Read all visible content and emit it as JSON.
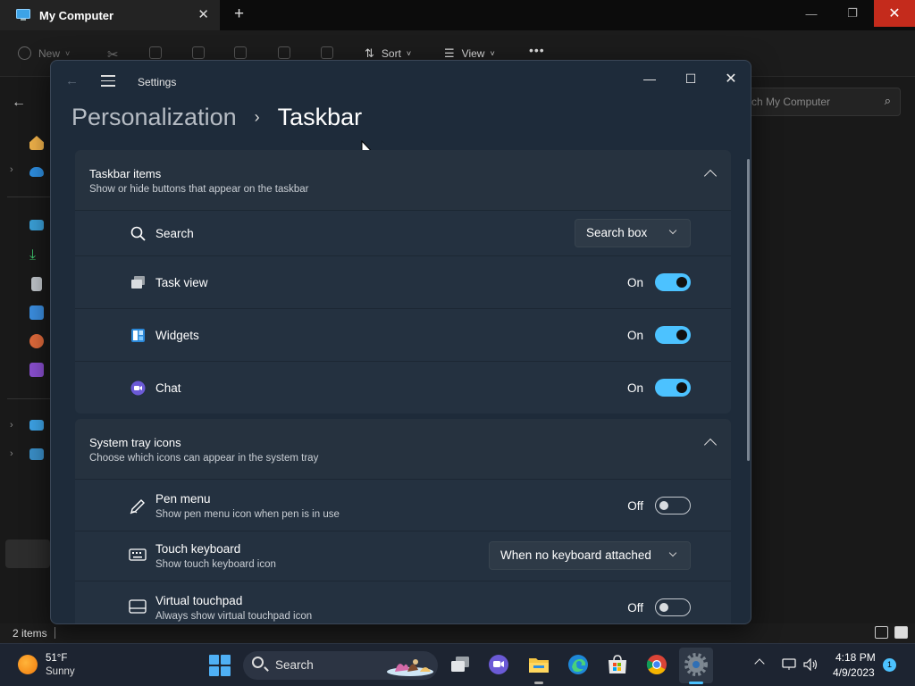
{
  "explorer": {
    "tab_title": "My Computer",
    "tab_close": "✕",
    "new_tab": "+",
    "window_buttons": {
      "minimize": "—",
      "maximize": "❐",
      "close": "✕"
    },
    "toolbar": {
      "new": "New",
      "sort": "Sort",
      "view": "View",
      "more": "•••",
      "cut_icon": "✂"
    },
    "back": "←",
    "search_placeholder": "Search My Computer",
    "search_display": "ch My Computer",
    "search_icon": "⌕",
    "status_text": "2 items"
  },
  "settings": {
    "app_title": "Settings",
    "back_icon": "←",
    "window_buttons": {
      "minimize": "—",
      "maximize": "☐",
      "close": "✕"
    },
    "breadcrumb": {
      "parent": "Personalization",
      "separator": "›",
      "current": "Taskbar"
    },
    "sections": {
      "taskbar_items": {
        "title": "Taskbar items",
        "subtitle": "Show or hide buttons that appear on the taskbar",
        "search": {
          "label": "Search",
          "value": "Search box"
        },
        "task_view": {
          "label": "Task view",
          "state": "On"
        },
        "widgets": {
          "label": "Widgets",
          "state": "On"
        },
        "chat": {
          "label": "Chat",
          "state": "On"
        }
      },
      "system_tray": {
        "title": "System tray icons",
        "subtitle": "Choose which icons can appear in the system tray",
        "pen_menu": {
          "label": "Pen menu",
          "subtitle": "Show pen menu icon when pen is in use",
          "state": "Off"
        },
        "touch_keyboard": {
          "label": "Touch keyboard",
          "subtitle": "Show touch keyboard icon",
          "value": "When no keyboard attached"
        },
        "virtual_touchpad": {
          "label": "Virtual touchpad",
          "subtitle": "Always show virtual touchpad icon",
          "state": "Off"
        }
      }
    }
  },
  "taskbar": {
    "weather_temp": "51°F",
    "weather_cond": "Sunny",
    "search_label": "Search",
    "time": "4:18 PM",
    "date": "4/9/2023",
    "notification_count": "1"
  },
  "colors": {
    "accent": "#4cc2ff",
    "settings_bg": "#1e2b3a",
    "card_bg": "#243140",
    "close_red": "#c42b1c"
  }
}
